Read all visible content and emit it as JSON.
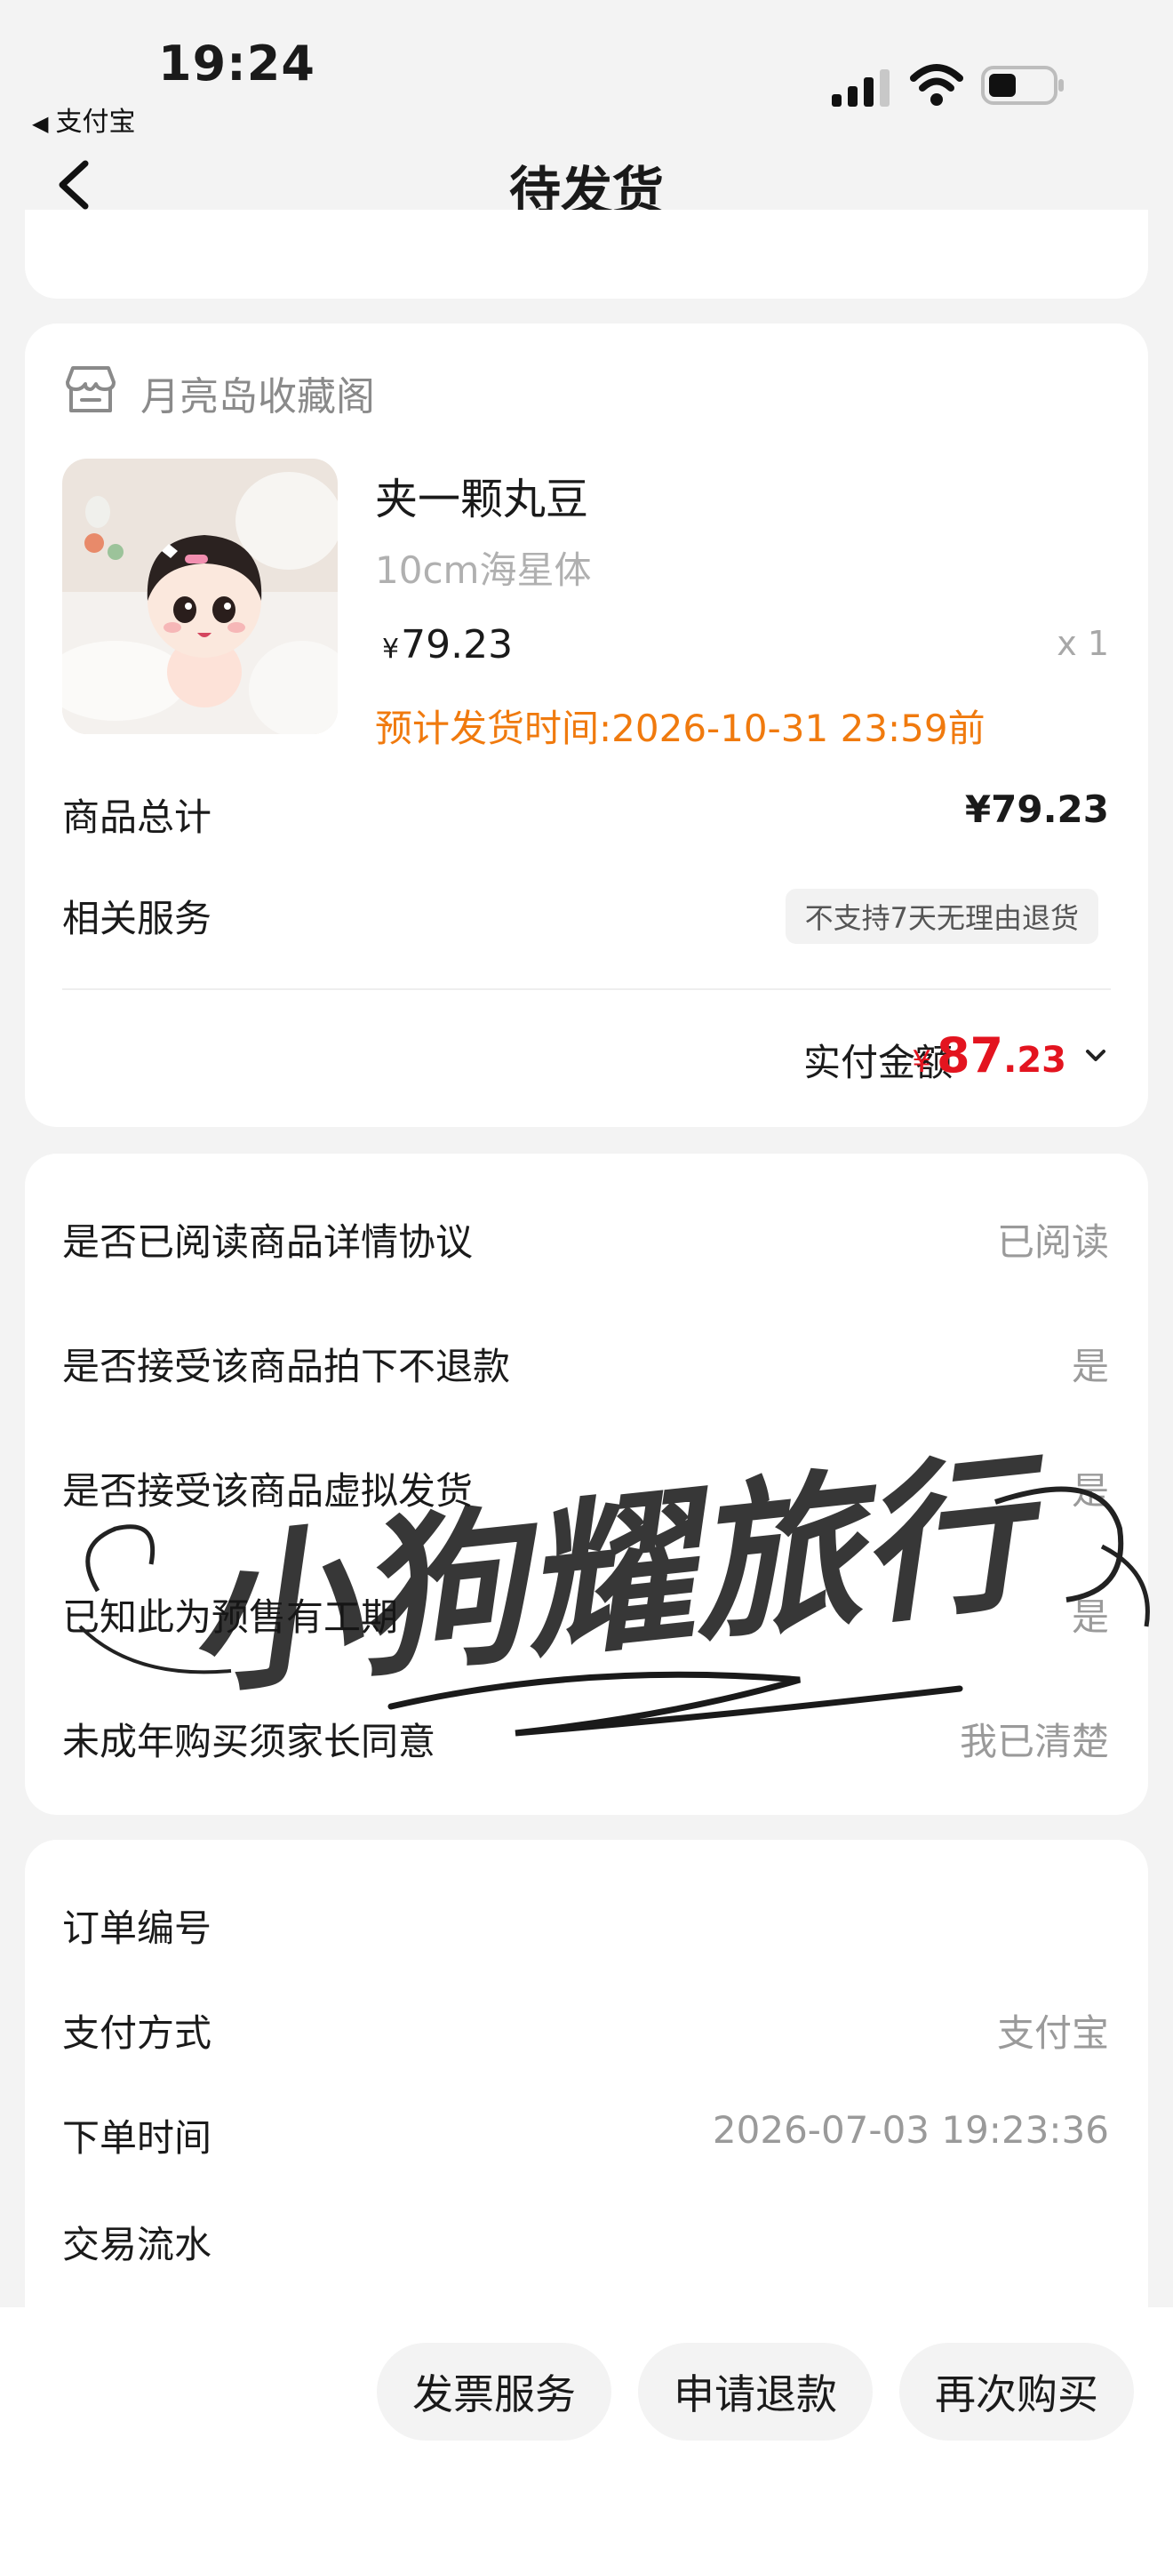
{
  "status_bar": {
    "time": "19:24",
    "back_app": "支付宝"
  },
  "nav": {
    "title": "待发货"
  },
  "shop": {
    "name": "月亮岛收藏阁"
  },
  "product": {
    "name": "夹一颗丸豆",
    "spec": "10cm海星体",
    "currency": "¥",
    "price": "79.23",
    "qty": "x 1",
    "ship_note": "预计发货时间:2026-10-31 23:59前"
  },
  "summary": {
    "total_label": "商品总计",
    "total_value": "¥79.23",
    "service_label": "相关服务",
    "service_tag": "不支持7天无理由退货",
    "paid_label": "实付金额",
    "paid_currency": "¥",
    "paid_int": "87",
    "paid_dec": ".23"
  },
  "agreements": [
    {
      "label": "是否已阅读商品详情协议",
      "value": "已阅读"
    },
    {
      "label": "是否接受该商品拍下不退款",
      "value": "是"
    },
    {
      "label": "是否接受该商品虚拟发货",
      "value": "是"
    },
    {
      "label": "已知此为预售有工期",
      "value": "是"
    },
    {
      "label": "未成年购买须家长同意",
      "value": "我已清楚"
    }
  ],
  "order_info": [
    {
      "label": "订单编号",
      "value": ""
    },
    {
      "label": "支付方式",
      "value": "支付宝"
    },
    {
      "label": "下单时间",
      "value": "2026-07-03 19:23:36"
    },
    {
      "label": "交易流水",
      "value": ""
    }
  ],
  "actions": {
    "invoice": "发票服务",
    "refund": "申请退款",
    "rebuy": "再次购买"
  },
  "watermark": "小狗耀旅行",
  "colors": {
    "accent_red": "#e3141f",
    "ship_orange": "#f07a0e",
    "background": "#f3f3f3"
  }
}
